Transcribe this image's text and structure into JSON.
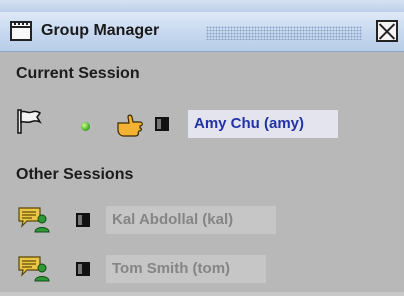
{
  "window": {
    "title": "Group Manager",
    "close_icon": "close-icon",
    "window_icon": "window-icon"
  },
  "current_session": {
    "label": "Current Session",
    "user": {
      "name": "Amy Chu (amy)",
      "icons": [
        "flag-icon",
        "online-status-icon",
        "pointing-hand-icon",
        "half-square-icon"
      ]
    }
  },
  "other_sessions": {
    "label": "Other Sessions",
    "users": [
      {
        "name": "Kal Abdollal (kal)",
        "icons": [
          "chat-user-icon",
          "half-square-icon"
        ]
      },
      {
        "name": "Tom Smith (tom)",
        "icons": [
          "chat-user-icon",
          "half-square-icon"
        ]
      }
    ]
  },
  "colors": {
    "background": "#b8b8b8",
    "titlebar": "#c6d8ef",
    "current_name_text": "#2233a8",
    "current_name_bg": "#e4e4ee",
    "other_name_text": "#858585",
    "other_name_bg": "#c6c6c6"
  }
}
